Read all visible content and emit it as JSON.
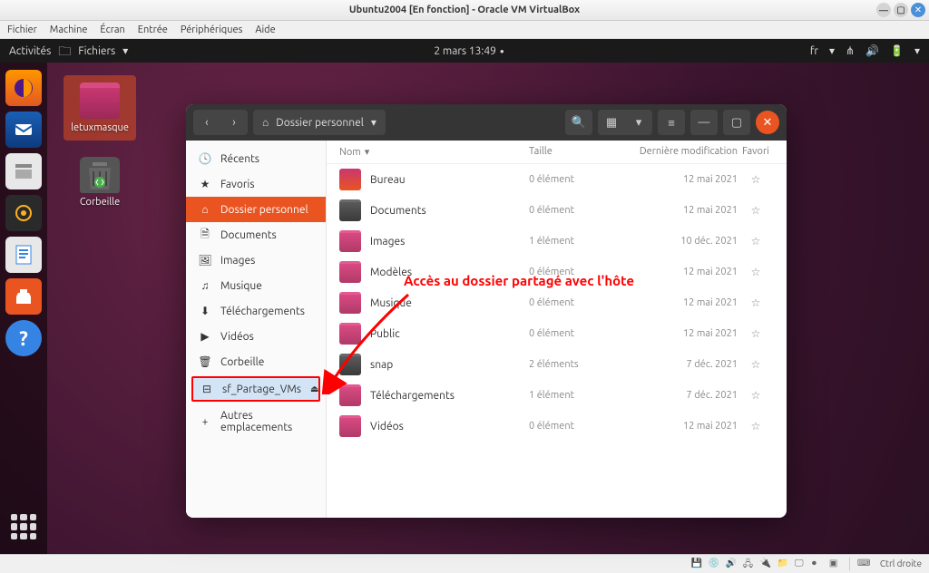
{
  "vbox": {
    "title": "Ubuntu2004 [En fonction] - Oracle VM VirtualBox",
    "menus": [
      "Fichier",
      "Machine",
      "Écran",
      "Entrée",
      "Périphériques",
      "Aide"
    ],
    "status_host": "Ctrl droite"
  },
  "gnome": {
    "activities": "Activités",
    "app_name": "Fichiers",
    "datetime": "2 mars  13:49",
    "lang": "fr"
  },
  "desktop": {
    "icons": [
      {
        "label": "letuxmasque",
        "type": "folder"
      },
      {
        "label": "Corbeille",
        "type": "trash"
      }
    ]
  },
  "nautilus": {
    "path": "Dossier personnel",
    "columns": {
      "name": "Nom",
      "size": "Taille",
      "modified": "Dernière modification",
      "fav": "Favori"
    },
    "sidebar": [
      {
        "icon": "clock",
        "label": "Récents"
      },
      {
        "icon": "star",
        "label": "Favoris"
      },
      {
        "icon": "home",
        "label": "Dossier personnel",
        "active": true
      },
      {
        "icon": "docs",
        "label": "Documents"
      },
      {
        "icon": "image",
        "label": "Images"
      },
      {
        "icon": "music",
        "label": "Musique"
      },
      {
        "icon": "download",
        "label": "Téléchargements"
      },
      {
        "icon": "video",
        "label": "Vidéos"
      },
      {
        "icon": "trash",
        "label": "Corbeille"
      },
      {
        "icon": "disk",
        "label": "sf_Partage_VMs",
        "highlighted": true,
        "eject": true
      },
      {
        "icon": "plus",
        "label": "Autres emplacements"
      }
    ],
    "files": [
      {
        "name": "Bureau",
        "size": "0 élément",
        "date": "12 mai 2021",
        "icon": "desktop"
      },
      {
        "name": "Documents",
        "size": "0 élément",
        "date": "12 mai 2021",
        "icon": "dark"
      },
      {
        "name": "Images",
        "size": "1 élément",
        "date": "10 déc. 2021",
        "icon": "folder"
      },
      {
        "name": "Modèles",
        "size": "0 élément",
        "date": "12 mai 2021",
        "icon": "folder"
      },
      {
        "name": "Musique",
        "size": "0 élément",
        "date": "12 mai 2021",
        "icon": "folder"
      },
      {
        "name": "Public",
        "size": "0 élément",
        "date": "12 mai 2021",
        "icon": "folder"
      },
      {
        "name": "snap",
        "size": "2 éléments",
        "date": "7 déc. 2021",
        "icon": "dark"
      },
      {
        "name": "Téléchargements",
        "size": "1 élément",
        "date": "7 déc. 2021",
        "icon": "folder"
      },
      {
        "name": "Vidéos",
        "size": "0 élément",
        "date": "12 mai 2021",
        "icon": "folder"
      }
    ]
  },
  "annotation": "Accès au dossier partagé avec l'hôte"
}
